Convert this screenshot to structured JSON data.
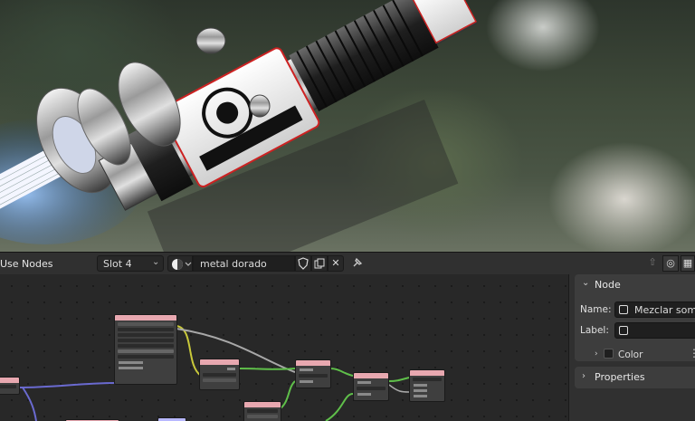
{
  "header": {
    "use_nodes_label": "Use Nodes",
    "slot_label": "Slot 4",
    "material_name": "metal dorado",
    "icons": [
      "fake-user-shield-icon",
      "copy-icon",
      "close-icon",
      "pin-icon"
    ]
  },
  "sidebar": {
    "node_panel_title": "Node",
    "name_label": "Name:",
    "name_value": "Mezclar sombra",
    "label_label": "Label:",
    "label_value": "",
    "color_label": "Color",
    "properties_title": "Properties"
  },
  "colors": {
    "accent_header": "#e8a8b0",
    "link_green": "#5fbf4a",
    "link_yellow": "#c8c83a",
    "link_grey": "#a8a8a8",
    "link_purple": "#6a6ad0"
  }
}
